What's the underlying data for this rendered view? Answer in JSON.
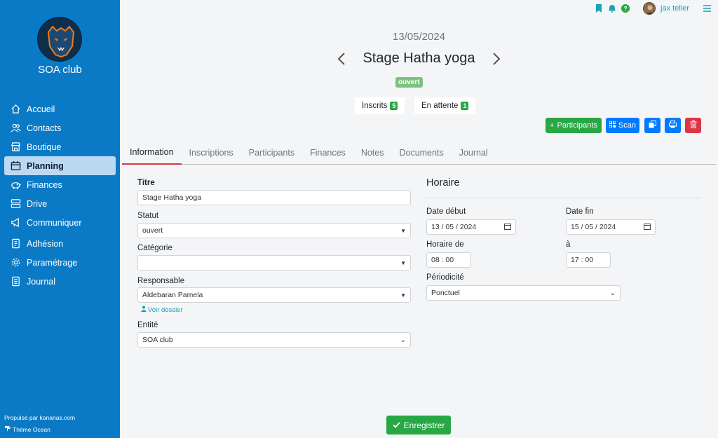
{
  "sidebar": {
    "club_name": "SOA club",
    "items": [
      {
        "label": "Accueil",
        "icon": "home-icon"
      },
      {
        "label": "Contacts",
        "icon": "users-icon"
      },
      {
        "label": "Boutique",
        "icon": "shop-icon"
      },
      {
        "label": "Planning",
        "icon": "calendar-icon",
        "active": true
      },
      {
        "label": "Finances",
        "icon": "piggy-bank-icon"
      },
      {
        "label": "Drive",
        "icon": "drive-icon"
      },
      {
        "label": "Communiquer",
        "icon": "megaphone-icon"
      },
      {
        "label": "Adhésion",
        "icon": "membership-icon"
      },
      {
        "label": "Paramétrage",
        "icon": "gear-icon"
      },
      {
        "label": "Journal",
        "icon": "journal-icon"
      }
    ],
    "footer_powered": "Propulsé par kananas.com",
    "footer_theme": "Thème Ocean"
  },
  "topbar": {
    "username": "jax teller",
    "help": "?"
  },
  "event": {
    "date": "13/05/2024",
    "title": "Stage Hatha yoga",
    "status": "ouvert",
    "inscrits_label": "Inscrits",
    "inscrits_count": "5",
    "attente_label": "En attente",
    "attente_count": "1"
  },
  "actions": {
    "participants_label": "Participants",
    "scan_label": "Scan"
  },
  "tabs": [
    "Information",
    "Inscriptions",
    "Participants",
    "Finances",
    "Notes",
    "Documents",
    "Journal"
  ],
  "form": {
    "titre_label": "Titre",
    "titre_value": "Stage Hatha yoga",
    "statut_label": "Statut",
    "statut_value": "ouvert",
    "categorie_label": "Catégorie",
    "categorie_value": "",
    "responsable_label": "Responsable",
    "responsable_value": "Aldebaran Pamela",
    "voir_dossier": "Voir dossier",
    "entite_label": "Entité",
    "entite_value": "SOA club"
  },
  "horaire": {
    "title": "Horaire",
    "date_debut_label": "Date début",
    "date_debut_value": "13 / 05 / 2024",
    "date_fin_label": "Date fin",
    "date_fin_value": "15 / 05 / 2024",
    "horaire_de_label": "Horaire de",
    "horaire_de_value": "08 : 00",
    "a_label": "à",
    "a_value": "17 : 00",
    "periodicite_label": "Périodicité",
    "periodicite_value": "Ponctuel"
  },
  "save_label": "Enregistrer",
  "colors": {
    "sidebar": "#0b7ac6",
    "active_nav": "#bcd9f4",
    "green": "#28a745",
    "blue": "#007bff",
    "red": "#dc3545",
    "teal": "#17a2b8"
  }
}
